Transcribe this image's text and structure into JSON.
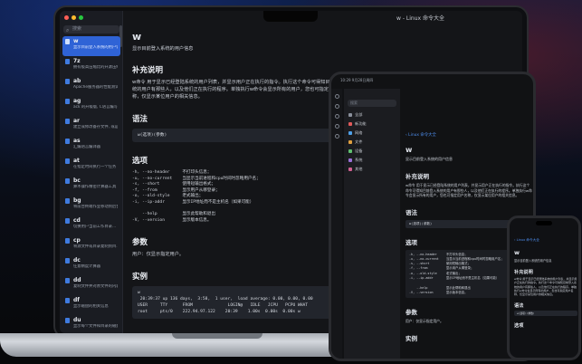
{
  "window": {
    "title": "w - Linux 命令大全"
  },
  "sidebar": {
    "search_placeholder": "搜索",
    "items": [
      {
        "name": "w",
        "desc": "显示目前登入系统的用户信息",
        "active": true
      },
      {
        "name": "7z",
        "desc": "拥有极高压缩比的开源压缩..."
      },
      {
        "name": "ab",
        "desc": "Apache服务器的性能测试..."
      },
      {
        "name": "ag",
        "desc": "ack 的升级版, C语言编写..."
      },
      {
        "name": "ar",
        "desc": "建立或修改备存文件, 或是..."
      },
      {
        "name": "as",
        "desc": "汇编语言编译器"
      },
      {
        "name": "at",
        "desc": "在指定时间执行一个任务"
      },
      {
        "name": "bc",
        "desc": "算术操作精密计算器工具"
      },
      {
        "name": "bg",
        "desc": "将前台终端作业移动到后台..."
      },
      {
        "name": "cd",
        "desc": "切换用户当前工作目录..."
      },
      {
        "name": "cp",
        "desc": "将源文件或目录复制到目..."
      },
      {
        "name": "dc",
        "desc": "任意精度计算器"
      },
      {
        "name": "dd",
        "desc": "复制文件并对原文件的内容..."
      },
      {
        "name": "df",
        "desc": "显示磁盘的相关信息"
      },
      {
        "name": "du",
        "desc": "显示每个文件和目录的磁盘..."
      }
    ]
  },
  "main": {
    "command": "w",
    "description": "显示目前登入系统的用户信息",
    "sections": {
      "supplement_title": "补充说明",
      "supplement_text": "w命令 用于显示已经登陆系统的用户列表，并显示用户正在执行的指令。执行这个命令可得知目前登入系统的用户有那些人，以及他们正在执行的程序。单独执行w命令会显示所有的用户，您也可指定用户名称，仅显示某位用户的相关信息。",
      "syntax_title": "语法",
      "syntax_code": "w(选项)(参数)",
      "options_title": "选项",
      "options_code": "-h, --no-header     不打印头信息；\n-u, --no-current    当显示当前进程和cpu时间时忽略用户名；\n-s, --short         使用短输出格式；\n-f, --from          显示用户从哪登录；\n-o, --old-style     老式输出；\n-i, --ip-addr       显示IP地址而不是主机名（如果可能）\n\n    --help          显示此帮助和退出\n-V, --version       显示版本信息。",
      "params_title": "参数",
      "params_text": "用户：仅显示指定用户。",
      "example_title": "实例",
      "example_code": "w\n 20:39:37 up 136 days,  3:58,  1 user,  load average: 0.00, 0.00, 0.00\nUSER     TTY      FROM              LOGIN@   IDLE   JCPU   PCPU WHAT\nroot     pts/0    222.94.97.122    20:39    1.00s  0.00s  0.00s w"
    }
  },
  "tablet": {
    "status_time": "10:29 9月28日周四",
    "search_placeholder": "搜索",
    "categories": [
      {
        "label": "全部",
        "color": "#8a909c"
      },
      {
        "label": "新功能",
        "color": "#e05a5a"
      },
      {
        "label": "网络",
        "color": "#4fa0e8"
      },
      {
        "label": "文件",
        "color": "#e0a040"
      },
      {
        "label": "设备",
        "color": "#60c070"
      },
      {
        "label": "系统",
        "color": "#9a70d8"
      },
      {
        "label": "其他",
        "color": "#d06090"
      }
    ],
    "back_label": "Linux 命令大全"
  },
  "phone": {
    "back_label": "Linux 命令大全"
  },
  "colors": {
    "accent": "#2f63d6",
    "link": "#4f8ff0"
  }
}
